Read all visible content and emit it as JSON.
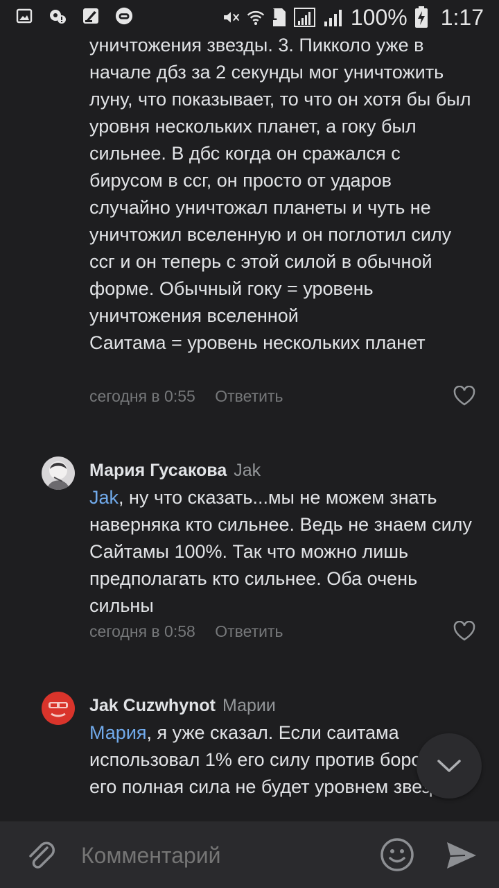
{
  "status_bar": {
    "battery_percent": "100%",
    "time": "1:17",
    "sim_badge": "1",
    "icons": [
      "image-icon",
      "location-alert-icon",
      "clean-app-icon",
      "vk-app-icon",
      "mute-icon",
      "wifi-icon",
      "sim-icon",
      "signal-icon",
      "signal-icon",
      "battery-charging-icon"
    ]
  },
  "comments": [
    {
      "text": "уничтожения звезды. 3. Пикколо уже в начале дбз за 2 секунды мог уничтожить луну, что показывает, то что он хотя бы был уровня нескольких планет, а гоку был сильнее. В дбс когда он сражался с бирусом в ссг, он просто от ударов случайно уничтожал планеты и чуть не уничтожил вселенную и он поглотил силу ссг и он теперь с этой силой в обычной форме. Обычный гоку = уровень уничтожения вселенной",
      "text_extra": "Саитама = уровень нескольких планет",
      "time": "сегодня в 0:55",
      "reply_label": "Ответить"
    },
    {
      "author": "Мария Гусакова",
      "reply_to": "Jak",
      "mention": "Jak",
      "text": ", ну что сказать...мы не можем знать наверняка кто сильнее. Ведь не знаем силу Сайтамы 100%. Так что можно лишь предполагать кто сильнее. Оба очень сильны",
      "time": "сегодня в 0:58",
      "reply_label": "Ответить"
    },
    {
      "author": "Jak Cuzwhynot",
      "reply_to": "Марии",
      "mention": "Мария",
      "text": ", я уже сказал. Если саитама использовал 1% его силу против бороса, то его полная сила не будет уровнем звезды"
    }
  ],
  "composer": {
    "placeholder": "Комментарий"
  },
  "colors": {
    "background": "#1e1e20",
    "mention": "#71aaeb",
    "meta": "#76787a"
  }
}
